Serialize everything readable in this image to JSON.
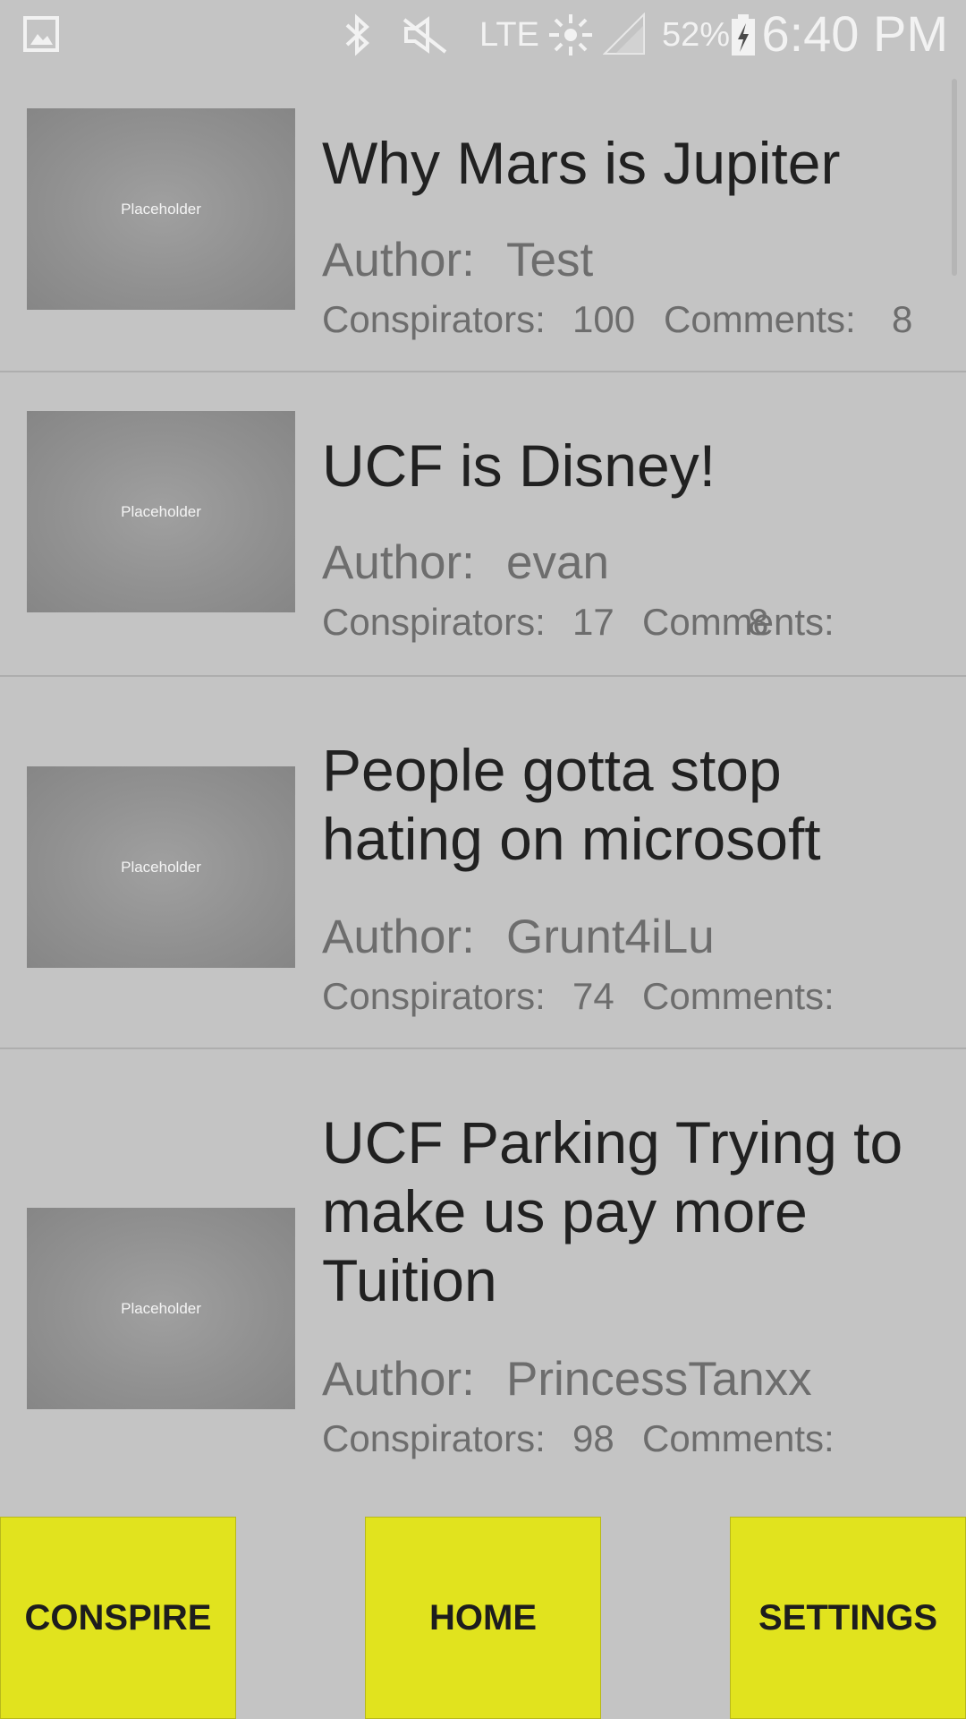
{
  "status_bar": {
    "battery": "52%",
    "network": "LTE",
    "time": "6:40 PM"
  },
  "posts": [
    {
      "thumbnail_label": "Placeholder",
      "title": "Why Mars is Jupiter",
      "author_label": "Author:",
      "author": "Test",
      "conspirators_label": "Conspirators:",
      "conspirators": "100",
      "comments_label": "Comments:",
      "comments": "8"
    },
    {
      "thumbnail_label": "Placeholder",
      "title": "UCF is Disney!",
      "author_label": "Author:",
      "author": "evan",
      "conspirators_label": "Conspirators:",
      "conspirators": "17",
      "comments_label": "Comments:",
      "comments": "8"
    },
    {
      "thumbnail_label": "Placeholder",
      "title": "People gotta stop hating on microsoft",
      "author_label": "Author:",
      "author": "Grunt4iLu",
      "conspirators_label": "Conspirators:",
      "conspirators": "74",
      "comments_label": "Comments:",
      "comments": ""
    },
    {
      "thumbnail_label": "Placeholder",
      "title": "UCF Parking Trying to make us pay more Tuition",
      "author_label": "Author:",
      "author": "PrincessTanxx",
      "conspirators_label": "Conspirators:",
      "conspirators": "98",
      "comments_label": "Comments:",
      "comments": ""
    }
  ],
  "nav": {
    "conspire": "CONSPIRE",
    "home": "HOME",
    "settings": "SETTINGS"
  },
  "colors": {
    "background": "#c4c4c4",
    "button": "#e1e31e"
  }
}
